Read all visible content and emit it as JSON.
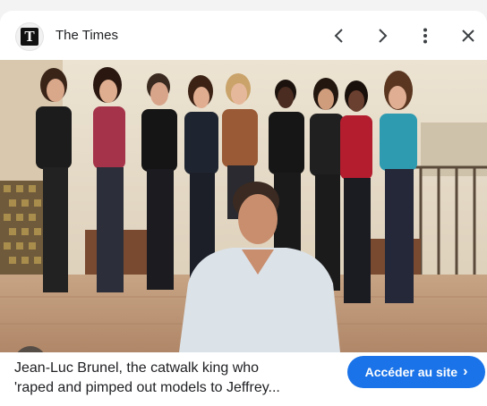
{
  "header": {
    "logo_letter": "T",
    "source_name": "The Times"
  },
  "icons": {
    "prev": "chevron-left-icon",
    "next": "chevron-right-icon",
    "more": "more-vert-icon",
    "close": "close-icon",
    "lens": "google-lens-icon"
  },
  "caption": {
    "line1": "Jean-Luc Brunel, the catwalk king who",
    "line2": "'raped and pimped out models to Jeffrey..."
  },
  "visit_button": {
    "label": "Accéder au site",
    "arrow": "›"
  },
  "colors": {
    "accent": "#1a73e8"
  }
}
